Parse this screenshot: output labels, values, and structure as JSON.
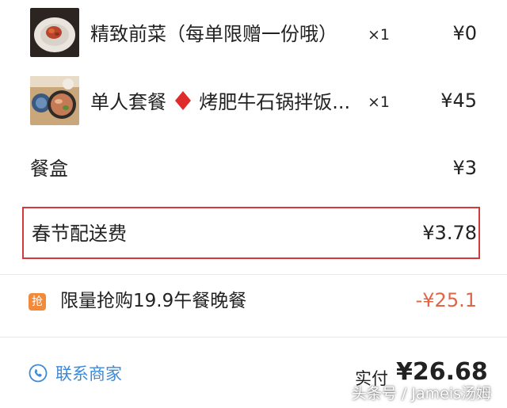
{
  "items": [
    {
      "name": "精致前菜（每单限赠一份哦）",
      "quantity": "×1",
      "price": "¥0",
      "thumbnail_icon": "appetizer-dish-photo"
    },
    {
      "name": "单人套餐",
      "name_suffix": "烤肥牛石锅拌饭...",
      "quantity": "×1",
      "price": "¥45",
      "thumbnail_icon": "set-meal-photo",
      "separator_icon": "red-diamond-icon"
    }
  ],
  "box_fee": {
    "label": "餐盒",
    "price": "¥3"
  },
  "delivery_fee": {
    "label": "春节配送费",
    "price": "¥3.78"
  },
  "discount": {
    "badge": "抢",
    "label": "限量抢购19.9午餐晚餐",
    "value": "-¥25.1"
  },
  "footer": {
    "contact_label": "联系商家",
    "contact_icon": "phone-icon",
    "total_label": "实付",
    "total_value": "¥26.68"
  },
  "watermark": "头条号 / Jameis汤姆",
  "colors": {
    "highlight_border": "#d43a3a",
    "discount_text": "#e06545",
    "badge_bg": "#f28a3c",
    "link_blue": "#3c8ad8"
  }
}
